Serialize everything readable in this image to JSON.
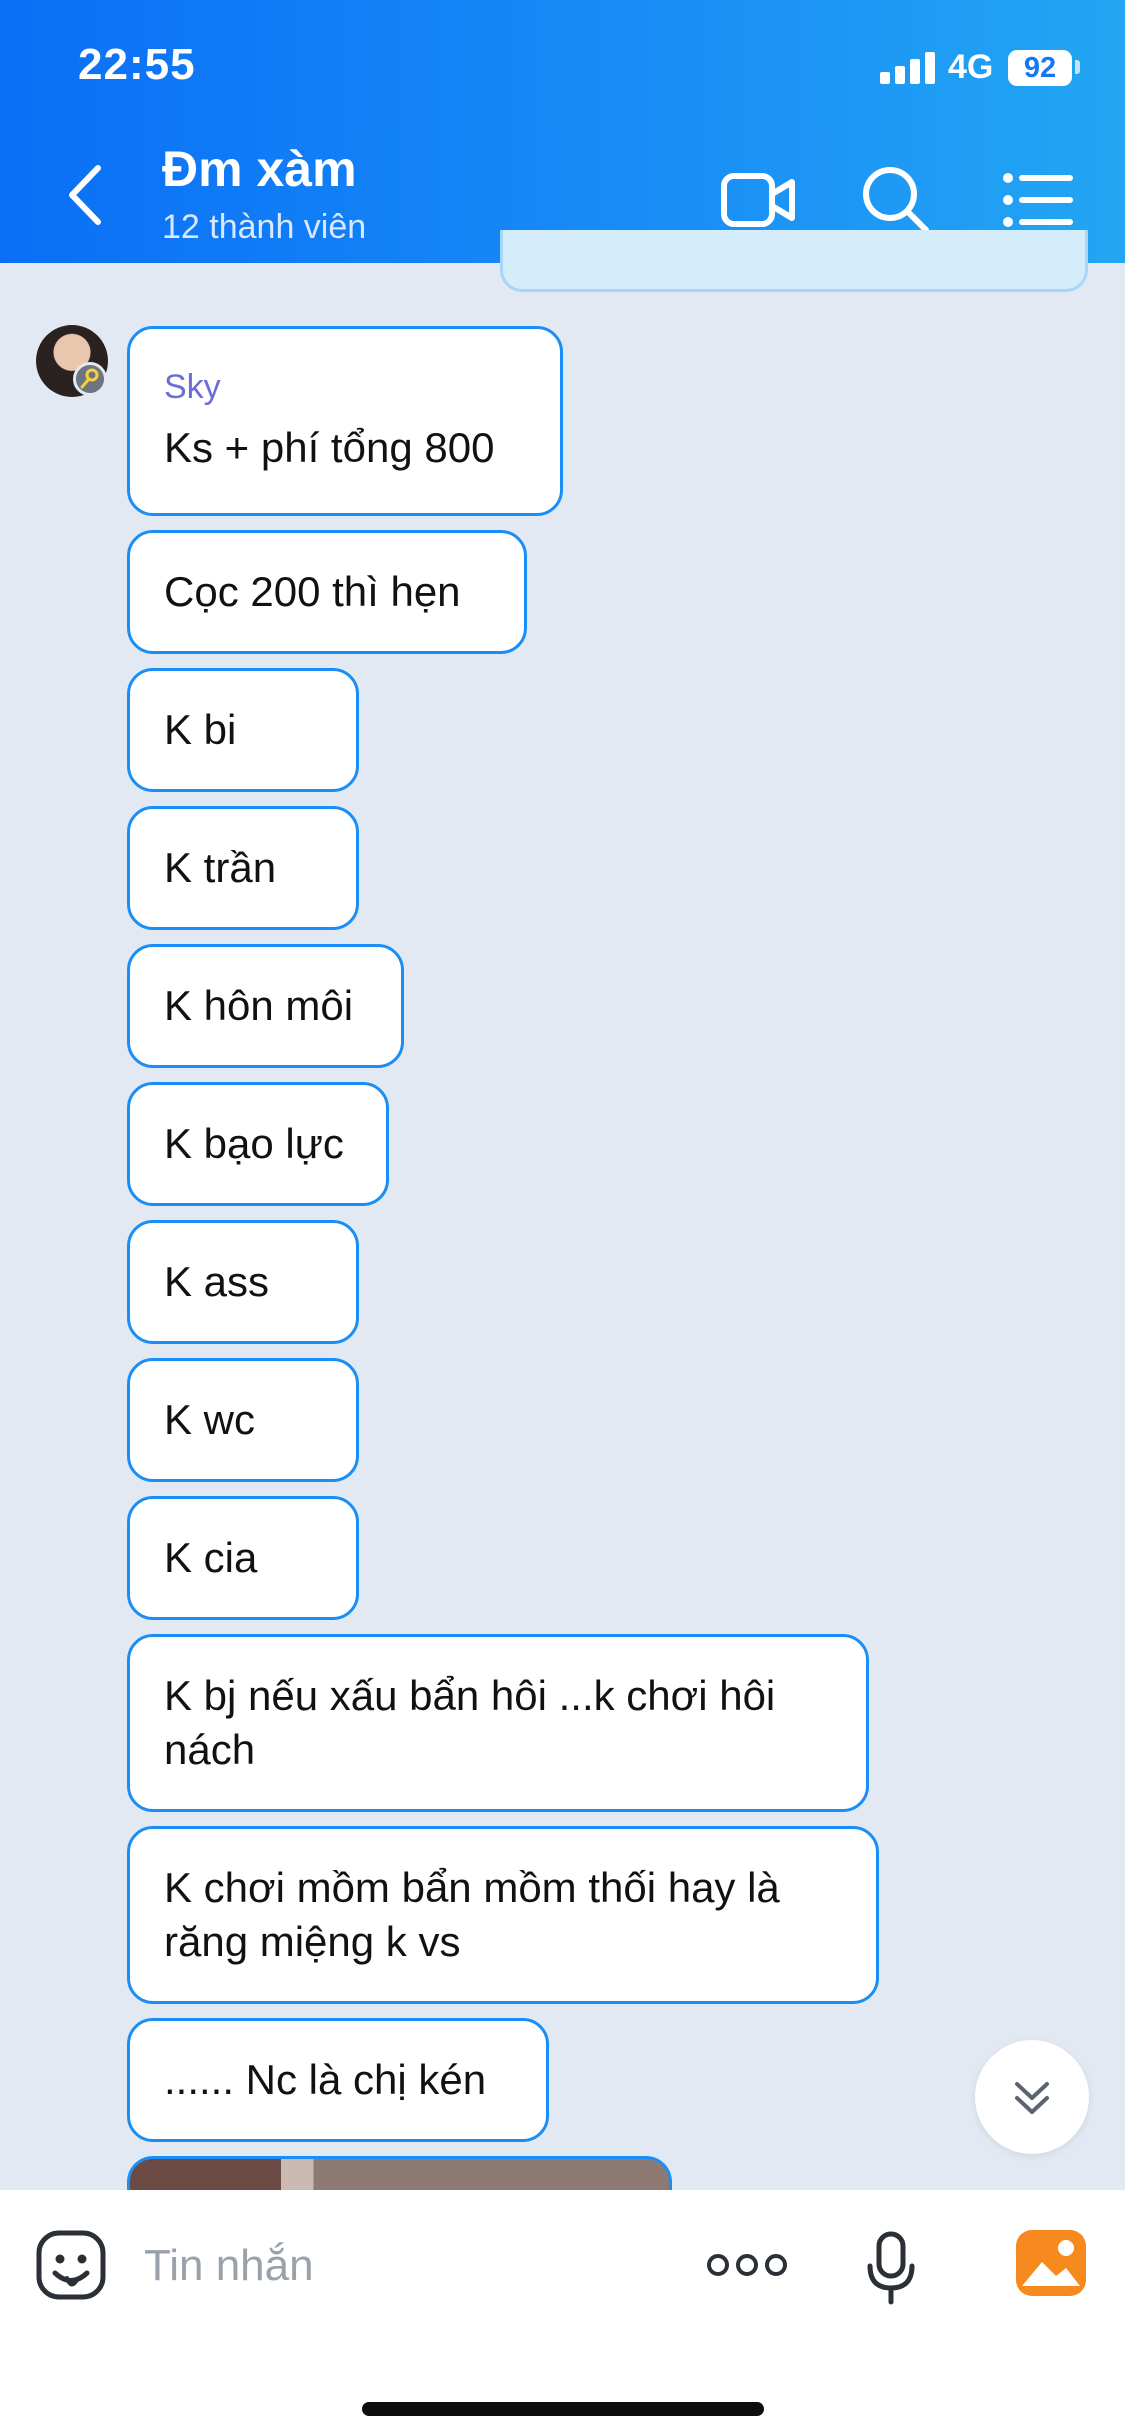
{
  "status_bar": {
    "time": "22:55",
    "network": "4G",
    "battery": "92"
  },
  "header": {
    "title": "Đm xàm",
    "subtitle": "12 thành viên"
  },
  "sender": {
    "name": "Sky"
  },
  "messages": [
    {
      "text": "Ks + phí tổng 800"
    },
    {
      "text": "Cọc 200 thì hẹn"
    },
    {
      "text": "K bi"
    },
    {
      "text": "K trần"
    },
    {
      "text": "K hôn môi"
    },
    {
      "text": "K bạo lực"
    },
    {
      "text": "K ass"
    },
    {
      "text": "K wc"
    },
    {
      "text": "K cia"
    },
    {
      "text": "K bj nếu xấu bẩn hôi ...k chơi hôi\nnách"
    },
    {
      "text": "K chơi mồm bẩn mồm thối hay là\nrăng miệng k vs"
    },
    {
      "text": "...... Nc là chị kén"
    }
  ],
  "input": {
    "placeholder": "Tin nhắn",
    "value": ""
  },
  "icons": {
    "back": "chevron-left-icon",
    "video": "video-call-icon",
    "search": "search-icon",
    "menu": "list-menu-icon",
    "sticker": "sticker-emoji-icon",
    "more": "more-dots-icon",
    "mic": "microphone-icon",
    "gallery": "gallery-image-icon",
    "scroll_down": "double-chevron-down-icon"
  },
  "colors": {
    "header_start": "#0a6ff5",
    "header_end": "#22a6f2",
    "chat_background": "#e2e9f2",
    "bubble_border": "#1a8ef7",
    "sender_name": "#6a6fd6",
    "gallery_orange": "#f68a1f"
  }
}
